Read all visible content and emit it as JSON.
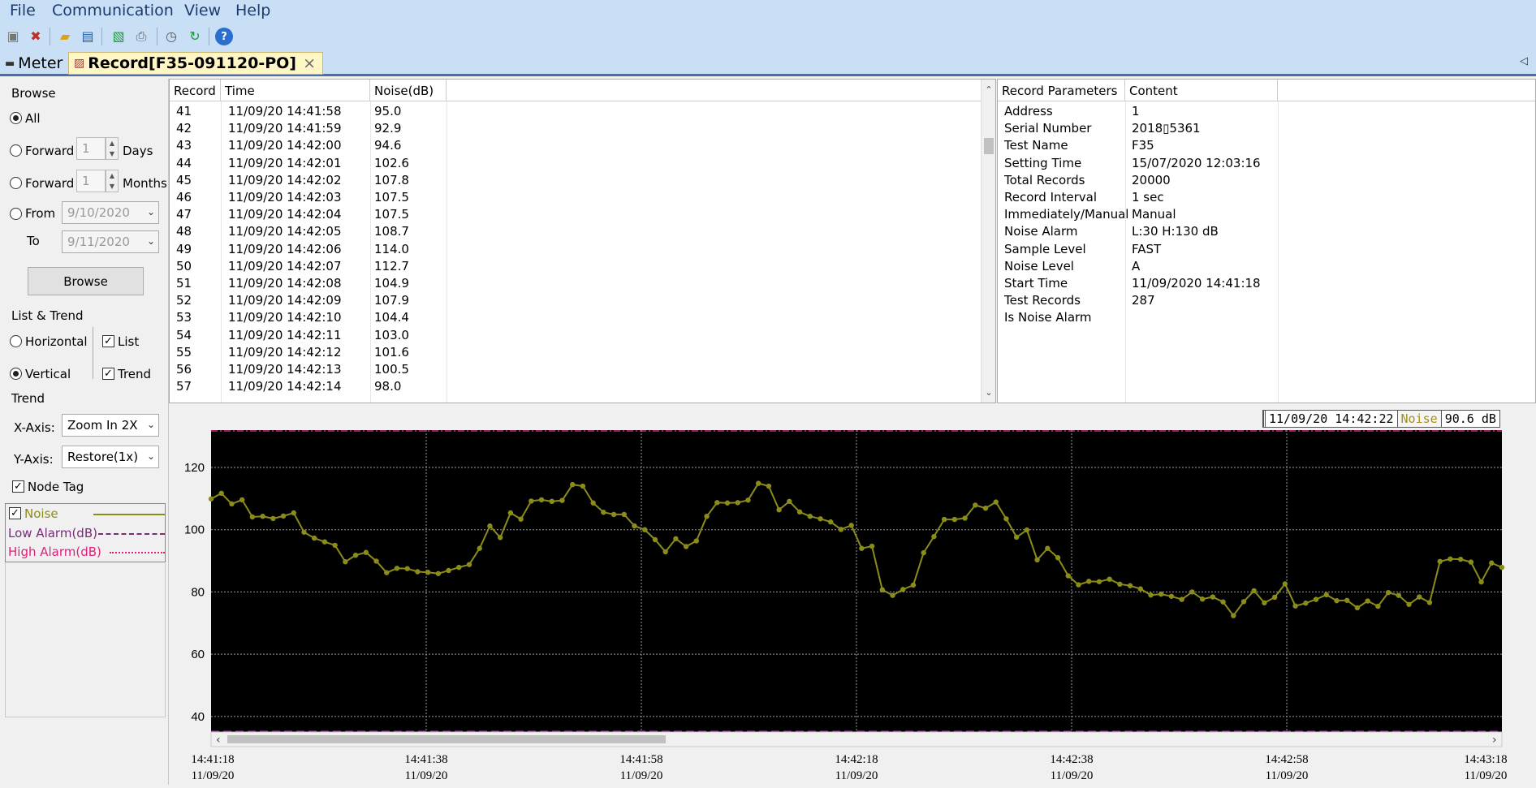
{
  "menu": [
    "File",
    "Communication",
    "View",
    "Help"
  ],
  "toolbar_icons": [
    "disconnect-icon",
    "delete-icon",
    "open-folder-icon",
    "save-icon",
    "export-icon",
    "print-icon",
    "clock-icon",
    "refresh-icon",
    "help-icon"
  ],
  "tabs": {
    "meter": "Meter",
    "record": "Record[F35-091120-PO]",
    "close": "×",
    "collapse": "◁"
  },
  "browse": {
    "group_label": "Browse",
    "all": "All",
    "forward_days_label": "Forward",
    "forward_days_value": "1",
    "days_unit": "Days",
    "forward_months_label": "Forward",
    "forward_months_value": "1",
    "months_unit": "Months",
    "from_label": "From",
    "from_date": "9/10/2020",
    "to_label": "To",
    "to_date": "9/11/2020",
    "browse_button": "Browse",
    "selected": "All"
  },
  "list_trend": {
    "group_label": "List & Trend",
    "horizontal": "Horizontal",
    "vertical": "Vertical",
    "list": "List",
    "trend": "Trend",
    "orientation": "Vertical",
    "list_checked": true,
    "trend_checked": true
  },
  "trend": {
    "group_label": "Trend",
    "xaxis_label": "X-Axis:",
    "xaxis_value": "Zoom In 2X",
    "yaxis_label": "Y-Axis:",
    "yaxis_value": "Restore(1x)",
    "node_tag": "Node Tag",
    "node_tag_checked": true
  },
  "legend": [
    {
      "name": "Noise",
      "color": "#8c8c1a",
      "checked": true,
      "style": "solid"
    },
    {
      "name": "Low Alarm(dB)",
      "color": "#7a2a7a",
      "style": "dash"
    },
    {
      "name": "High Alarm(dB)",
      "color": "#e0207a",
      "style": "dashdot"
    }
  ],
  "records": {
    "headers": [
      "Record",
      "Time",
      "Noise(dB)"
    ],
    "rows": [
      [
        "41",
        "11/09/20 14:41:58",
        "95.0"
      ],
      [
        "42",
        "11/09/20 14:41:59",
        "92.9"
      ],
      [
        "43",
        "11/09/20 14:42:00",
        "94.6"
      ],
      [
        "44",
        "11/09/20 14:42:01",
        "102.6"
      ],
      [
        "45",
        "11/09/20 14:42:02",
        "107.8"
      ],
      [
        "46",
        "11/09/20 14:42:03",
        "107.5"
      ],
      [
        "47",
        "11/09/20 14:42:04",
        "107.5"
      ],
      [
        "48",
        "11/09/20 14:42:05",
        "108.7"
      ],
      [
        "49",
        "11/09/20 14:42:06",
        "114.0"
      ],
      [
        "50",
        "11/09/20 14:42:07",
        "112.7"
      ],
      [
        "51",
        "11/09/20 14:42:08",
        "104.9"
      ],
      [
        "52",
        "11/09/20 14:42:09",
        "107.9"
      ],
      [
        "53",
        "11/09/20 14:42:10",
        "104.4"
      ],
      [
        "54",
        "11/09/20 14:42:11",
        "103.0"
      ],
      [
        "55",
        "11/09/20 14:42:12",
        "101.6"
      ],
      [
        "56",
        "11/09/20 14:42:13",
        "100.5"
      ],
      [
        "57",
        "11/09/20 14:42:14",
        "98.0"
      ]
    ]
  },
  "params": {
    "headers": [
      "Record Parameters",
      "Content"
    ],
    "rows": [
      [
        "Address",
        "1"
      ],
      [
        "Serial Number",
        "2018▯5361"
      ],
      [
        "Test Name",
        "F35"
      ],
      [
        "Setting Time",
        "15/07/2020 12:03:16"
      ],
      [
        "Total Records",
        "20000"
      ],
      [
        "Record Interval",
        "1 sec"
      ],
      [
        "Immediately/Manual",
        "Manual"
      ],
      [
        "Noise Alarm",
        "L:30 H:130 dB"
      ],
      [
        "Sample Level",
        "FAST"
      ],
      [
        "Noise Level",
        "A"
      ],
      [
        "Start Time",
        "11/09/2020 14:41:18"
      ],
      [
        "Test Records",
        "287"
      ],
      [
        "Is Noise Alarm",
        ""
      ]
    ]
  },
  "readout": {
    "time": "11/09/20 14:42:22",
    "series": "Noise",
    "value": "90.6 dB"
  },
  "chart_data": {
    "type": "line",
    "series": [
      {
        "name": "Noise",
        "color": "#8c8c1a",
        "values": [
          109.9,
          111.7,
          108.3,
          109.6,
          104.1,
          104.3,
          103.6,
          104.4,
          105.4,
          99.2,
          97.3,
          96.1,
          95.0,
          89.7,
          91.8,
          92.7,
          89.9,
          86.2,
          87.6,
          87.5,
          86.5,
          86.3,
          85.9,
          86.9,
          87.9,
          88.8,
          94.0,
          101.2,
          97.5,
          105.4,
          103.4,
          109.2,
          109.6,
          109.1,
          109.4,
          114.5,
          114.0,
          108.6,
          105.6,
          104.9,
          104.9,
          101.2,
          100.0,
          96.8,
          92.9,
          97.1,
          94.6,
          96.4,
          104.3,
          108.7,
          108.6,
          108.7,
          109.5,
          114.9,
          114.0,
          106.4,
          109.1,
          105.7,
          104.3,
          103.5,
          102.5,
          100.1,
          101.4,
          94.0,
          94.7,
          80.7,
          78.9,
          80.8,
          82.2,
          92.6,
          97.8,
          103.3,
          103.3,
          103.7,
          107.9,
          106.9,
          108.9,
          103.5,
          97.6,
          99.9,
          90.3,
          94.0,
          91.0,
          85.2,
          82.3,
          83.4,
          83.3,
          84.1,
          82.5,
          82.0,
          81.0,
          79.0,
          79.3,
          78.6,
          77.6,
          80.0,
          77.7,
          78.4,
          76.8,
          72.4,
          76.9,
          80.4,
          76.5,
          78.3,
          82.6,
          75.5,
          76.4,
          77.6,
          79.1,
          77.2,
          77.3,
          74.9,
          77.1,
          75.4,
          79.8,
          78.9,
          76.0,
          78.4,
          76.6,
          89.8,
          90.6,
          90.5,
          89.6,
          83.2,
          89.3,
          87.9
        ]
      }
    ],
    "y_ticks": [
      40,
      60,
      80,
      100,
      120
    ],
    "ylim": [
      35,
      132
    ],
    "x_tick_times": [
      "14:41:18",
      "14:41:38",
      "14:41:58",
      "14:42:18",
      "14:42:38",
      "14:42:58",
      "14:43:18"
    ],
    "x_tick_dates": [
      "11/09/20",
      "11/09/20",
      "11/09/20",
      "11/09/20",
      "11/09/20",
      "11/09/20",
      "11/09/20"
    ],
    "x_start_label": "14:41:18",
    "low_alarm": 30,
    "high_alarm": 130,
    "grid": true,
    "background": "#000000",
    "node_tag": true
  }
}
